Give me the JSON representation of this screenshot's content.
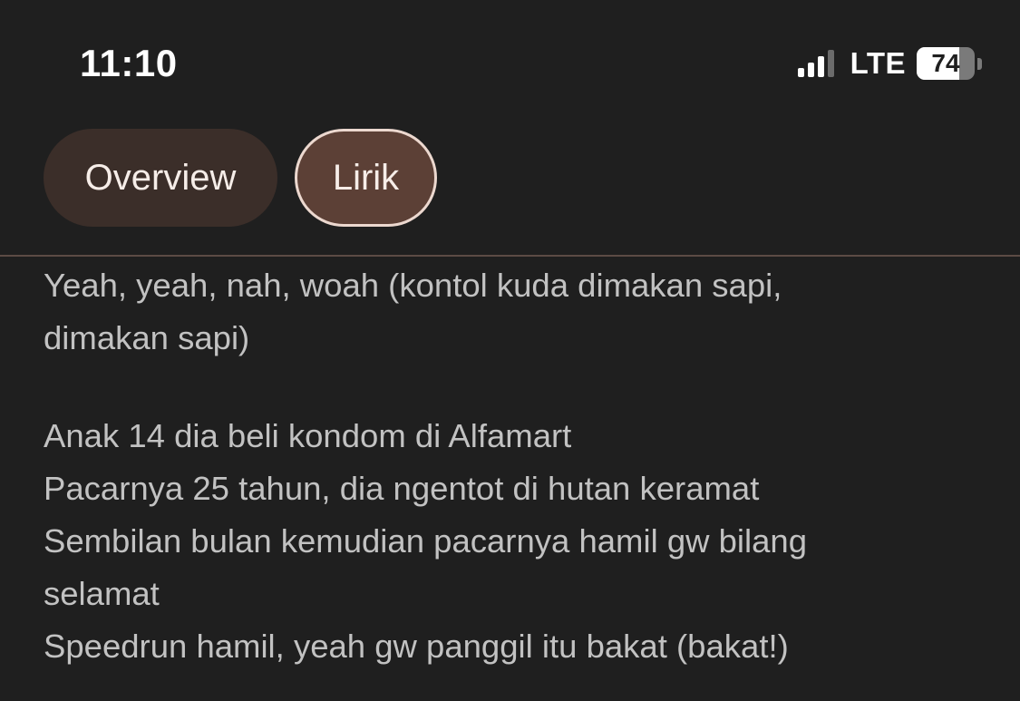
{
  "status_bar": {
    "time": "11:10",
    "network": "LTE",
    "battery_percent": "74",
    "battery_level": 0.74,
    "signal_bars_active": 3,
    "signal_bars_total": 4
  },
  "tabs": [
    {
      "label": "Overview",
      "selected": false
    },
    {
      "label": "Lirik",
      "selected": true
    }
  ],
  "lyrics": {
    "stanzas": [
      {
        "lines": [
          "Yeah, yeah, nah, woah (kontol kuda dimakan sapi,",
          "dimakan sapi)"
        ]
      },
      {
        "lines": [
          "Anak 14 dia beli kondom di Alfamart",
          "Pacarnya 25 tahun, dia ngentot di hutan keramat",
          "Sembilan bulan kemudian pacarnya hamil gw bilang",
          "selamat",
          "Speedrun hamil, yeah gw panggil itu bakat (bakat!)"
        ]
      }
    ]
  },
  "colors": {
    "background": "#1f1f1f",
    "tab_inactive": "#3b2e29",
    "tab_active": "#5c4036",
    "tab_active_border": "#ecd8cf",
    "lyrics_text": "#c2c2c2"
  }
}
